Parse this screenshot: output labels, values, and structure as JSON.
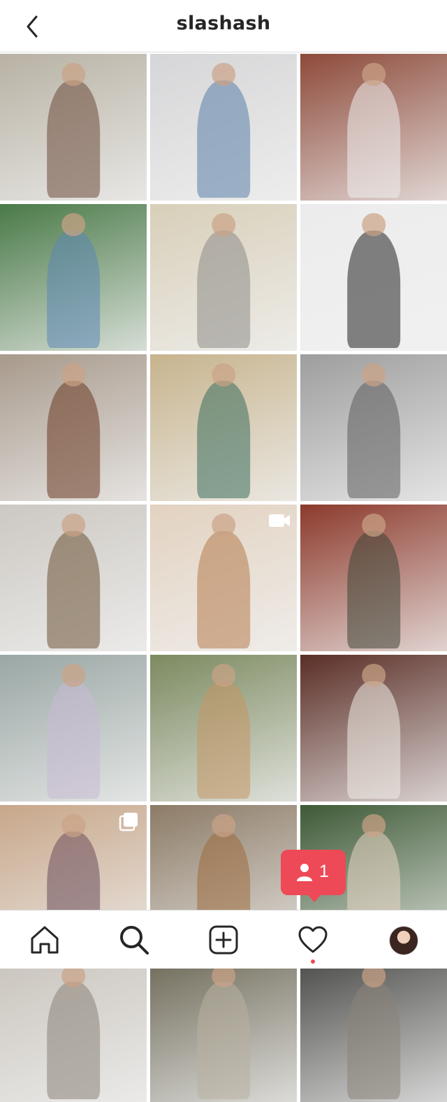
{
  "header": {
    "title": "slashash"
  },
  "grid": {
    "posts": [
      {
        "bg": "#b8b2a4",
        "fg": "#6d4c3c"
      },
      {
        "bg": "#d6d6d8",
        "fg": "#5a7fa8"
      },
      {
        "bg": "#8d4a3a",
        "fg": "#efefef"
      },
      {
        "bg": "#4a7a48",
        "fg": "#5b87b4"
      },
      {
        "bg": "#d8cfb9",
        "fg": "#8e8c88"
      },
      {
        "bg": "#ececec",
        "fg": "#222222"
      },
      {
        "bg": "#a89a8c",
        "fg": "#6b3a22"
      },
      {
        "bg": "#c7b48e",
        "fg": "#3b6e5c"
      },
      {
        "bg": "#9e9e9e",
        "fg": "#5c5c5c"
      },
      {
        "bg": "#ccc8c2",
        "fg": "#6e5336"
      },
      {
        "bg": "#e2d2c0",
        "fg": "#b57b4f",
        "type": "video"
      },
      {
        "bg": "#8c3a2c",
        "fg": "#3e4636"
      },
      {
        "bg": "#9aa7a4",
        "fg": "#c8b9d4"
      },
      {
        "bg": "#7c8a60",
        "fg": "#c49564"
      },
      {
        "bg": "#5a2e26",
        "fg": "#f0ede6"
      },
      {
        "bg": "#c7a78a",
        "fg": "#6c4e5c",
        "type": "carousel"
      },
      {
        "bg": "#8c7b66",
        "fg": "#9c6b3e"
      },
      {
        "bg": "#3e5a36",
        "fg": "#e9d6c4"
      },
      {
        "bg": "#c9c4bc",
        "fg": "#8a8478"
      },
      {
        "bg": "#6e6a58",
        "fg": "#b8b0a0"
      },
      {
        "bg": "#4a4a48",
        "fg": "#8a8478"
      }
    ]
  },
  "activity_popup": {
    "count": "1"
  },
  "nav": {
    "items": [
      "home",
      "search",
      "create",
      "activity",
      "profile"
    ],
    "colors": {
      "accent": "#ed4956",
      "icon": "#262626"
    }
  }
}
